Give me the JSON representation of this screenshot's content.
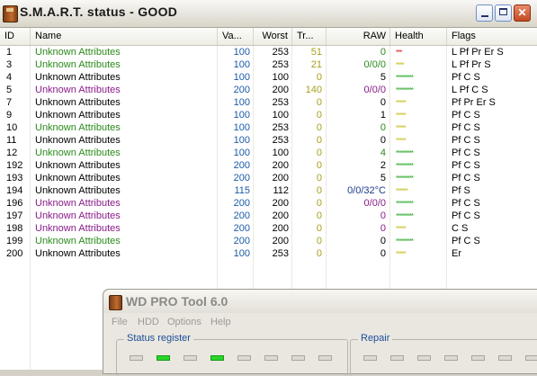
{
  "window": {
    "title": "S.M.A.R.T. status - GOOD",
    "controls": {
      "minimize": "_",
      "maximize": "□",
      "close": "✕"
    }
  },
  "table": {
    "columns": [
      "ID",
      "Name",
      "Va...",
      "Worst",
      "Tr...",
      "RAW",
      "Health",
      "Flags"
    ],
    "rows": [
      {
        "id": "1",
        "name": "Unknown Attributes",
        "value": "100",
        "worst": "253",
        "threshold": "51",
        "raw": "0",
        "health": "***",
        "flags": "L  Pf Pr Er S",
        "name_color": "#2a8a1a",
        "raw_color": "#2a8a1a",
        "health_color": "#e02020",
        "health_level": 3
      },
      {
        "id": "3",
        "name": "Unknown Attributes",
        "value": "100",
        "worst": "253",
        "threshold": "21",
        "raw": "0/0/0",
        "health": "****",
        "flags": "L  Pf Pr S",
        "name_color": "#2a8a1a",
        "raw_color": "#2a8a1a",
        "health_color": "#c8c020",
        "health_level": 4
      },
      {
        "id": "4",
        "name": "Unknown Attributes",
        "value": "100",
        "worst": "100",
        "threshold": "0",
        "raw": "5",
        "health": "*********",
        "flags": "Pf C  S",
        "name_color": "#000000",
        "raw_color": "#000000",
        "health_color": "#2aa82a",
        "health_level": 9
      },
      {
        "id": "5",
        "name": "Unknown Attributes",
        "value": "200",
        "worst": "200",
        "threshold": "140",
        "raw": "0/0/0",
        "health": "*********",
        "flags": "L  Pf C  S",
        "name_color": "#8a1a8a",
        "raw_color": "#8a1a8a",
        "health_color": "#2aa82a",
        "health_level": 9
      },
      {
        "id": "7",
        "name": "Unknown Attributes",
        "value": "100",
        "worst": "253",
        "threshold": "0",
        "raw": "0",
        "health": "*****",
        "flags": "Pf Pr Er S",
        "name_color": "#000000",
        "raw_color": "#000000",
        "health_color": "#c8c020",
        "health_level": 5
      },
      {
        "id": "9",
        "name": "Unknown Attributes",
        "value": "100",
        "worst": "100",
        "threshold": "0",
        "raw": "1",
        "health": "*****",
        "flags": "Pf C  S",
        "name_color": "#000000",
        "raw_color": "#000000",
        "health_color": "#c8c020",
        "health_level": 5
      },
      {
        "id": "10",
        "name": "Unknown Attributes",
        "value": "100",
        "worst": "253",
        "threshold": "0",
        "raw": "0",
        "health": "*****",
        "flags": "Pf C  S",
        "name_color": "#2a8a1a",
        "raw_color": "#2a8a1a",
        "health_color": "#c8c020",
        "health_level": 5
      },
      {
        "id": "11",
        "name": "Unknown Attributes",
        "value": "100",
        "worst": "253",
        "threshold": "0",
        "raw": "0",
        "health": "*****",
        "flags": "Pf C  S",
        "name_color": "#000000",
        "raw_color": "#000000",
        "health_color": "#c8c020",
        "health_level": 5
      },
      {
        "id": "12",
        "name": "Unknown Attributes",
        "value": "100",
        "worst": "100",
        "threshold": "0",
        "raw": "4",
        "health": "*********",
        "flags": "Pf C  S",
        "name_color": "#2a8a1a",
        "raw_color": "#2a8a1a",
        "health_color": "#2aa82a",
        "health_level": 9
      },
      {
        "id": "192",
        "name": "Unknown Attributes",
        "value": "200",
        "worst": "200",
        "threshold": "0",
        "raw": "2",
        "health": "*********",
        "flags": "Pf C  S",
        "name_color": "#000000",
        "raw_color": "#000000",
        "health_color": "#2aa82a",
        "health_level": 9
      },
      {
        "id": "193",
        "name": "Unknown Attributes",
        "value": "200",
        "worst": "200",
        "threshold": "0",
        "raw": "5",
        "health": "*********",
        "flags": "Pf C  S",
        "name_color": "#000000",
        "raw_color": "#000000",
        "health_color": "#2aa82a",
        "health_level": 9
      },
      {
        "id": "194",
        "name": "Unknown Attributes",
        "value": "115",
        "worst": "112",
        "threshold": "0",
        "raw": "0/0/32°C",
        "health": "******",
        "flags": "Pf S",
        "name_color": "#000000",
        "raw_color": "#1a3a8a",
        "health_color": "#c8c020",
        "health_level": 6
      },
      {
        "id": "196",
        "name": "Unknown Attributes",
        "value": "200",
        "worst": "200",
        "threshold": "0",
        "raw": "0/0/0",
        "health": "*********",
        "flags": "Pf C  S",
        "name_color": "#8a1a8a",
        "raw_color": "#8a1a8a",
        "health_color": "#2aa82a",
        "health_level": 9
      },
      {
        "id": "197",
        "name": "Unknown Attributes",
        "value": "200",
        "worst": "200",
        "threshold": "0",
        "raw": "0",
        "health": "*********",
        "flags": "Pf C  S",
        "name_color": "#8a1a8a",
        "raw_color": "#8a1a8a",
        "health_color": "#2aa82a",
        "health_level": 9
      },
      {
        "id": "198",
        "name": "Unknown Attributes",
        "value": "200",
        "worst": "200",
        "threshold": "0",
        "raw": "0",
        "health": "*****",
        "flags": "C  S",
        "name_color": "#8a1a8a",
        "raw_color": "#8a1a8a",
        "health_color": "#c8c020",
        "health_level": 5
      },
      {
        "id": "199",
        "name": "Unknown Attributes",
        "value": "200",
        "worst": "200",
        "threshold": "0",
        "raw": "0",
        "health": "*********",
        "flags": "Pf C  S",
        "name_color": "#2a8a1a",
        "raw_color": "#000000",
        "health_color": "#2aa82a",
        "health_level": 9
      },
      {
        "id": "200",
        "name": "Unknown Attributes",
        "value": "100",
        "worst": "253",
        "threshold": "0",
        "raw": "0",
        "health": "*****",
        "flags": "Er",
        "name_color": "#000000",
        "raw_color": "#000000",
        "health_color": "#c8c020",
        "health_level": 5
      }
    ]
  },
  "colors": {
    "value": "#1a5aa8",
    "threshold": "#a8a018"
  },
  "wdtool": {
    "title": "WD PRO Tool  6.0",
    "menu": [
      "File",
      "HDD",
      "Options",
      "Help"
    ],
    "status_group": "Status register",
    "repair_group": "Repair",
    "status_leds": [
      false,
      true,
      false,
      true,
      false,
      false,
      false,
      false
    ],
    "repair_leds": [
      false,
      false,
      false,
      false,
      false,
      false,
      false
    ]
  }
}
